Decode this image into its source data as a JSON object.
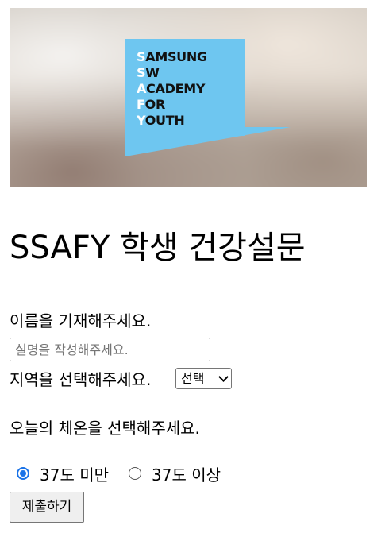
{
  "banner": {
    "logo_lines": [
      {
        "first": "S",
        "rest": "AMSUNG"
      },
      {
        "first": "S",
        "rest": "W"
      },
      {
        "first": "A",
        "rest": "CADEMY"
      },
      {
        "first": "F",
        "rest": "OR"
      },
      {
        "first": "Y",
        "rest": "OUTH"
      }
    ],
    "logo_color": "#6ec6f0"
  },
  "title": "SSAFY 학생 건강설문",
  "name": {
    "label": "이름을 기재해주세요.",
    "placeholder": "실명을 작성해주세요.",
    "value": ""
  },
  "region": {
    "label": "지역을 선택해주세요.",
    "selected": "선택"
  },
  "temperature": {
    "label": "오늘의 체온을 선택해주세요.",
    "options": [
      {
        "label": "37도 미만",
        "checked": true
      },
      {
        "label": "37도 이상",
        "checked": false
      }
    ]
  },
  "submit_label": "제출하기",
  "colors": {
    "accent": "#1a73e8"
  }
}
